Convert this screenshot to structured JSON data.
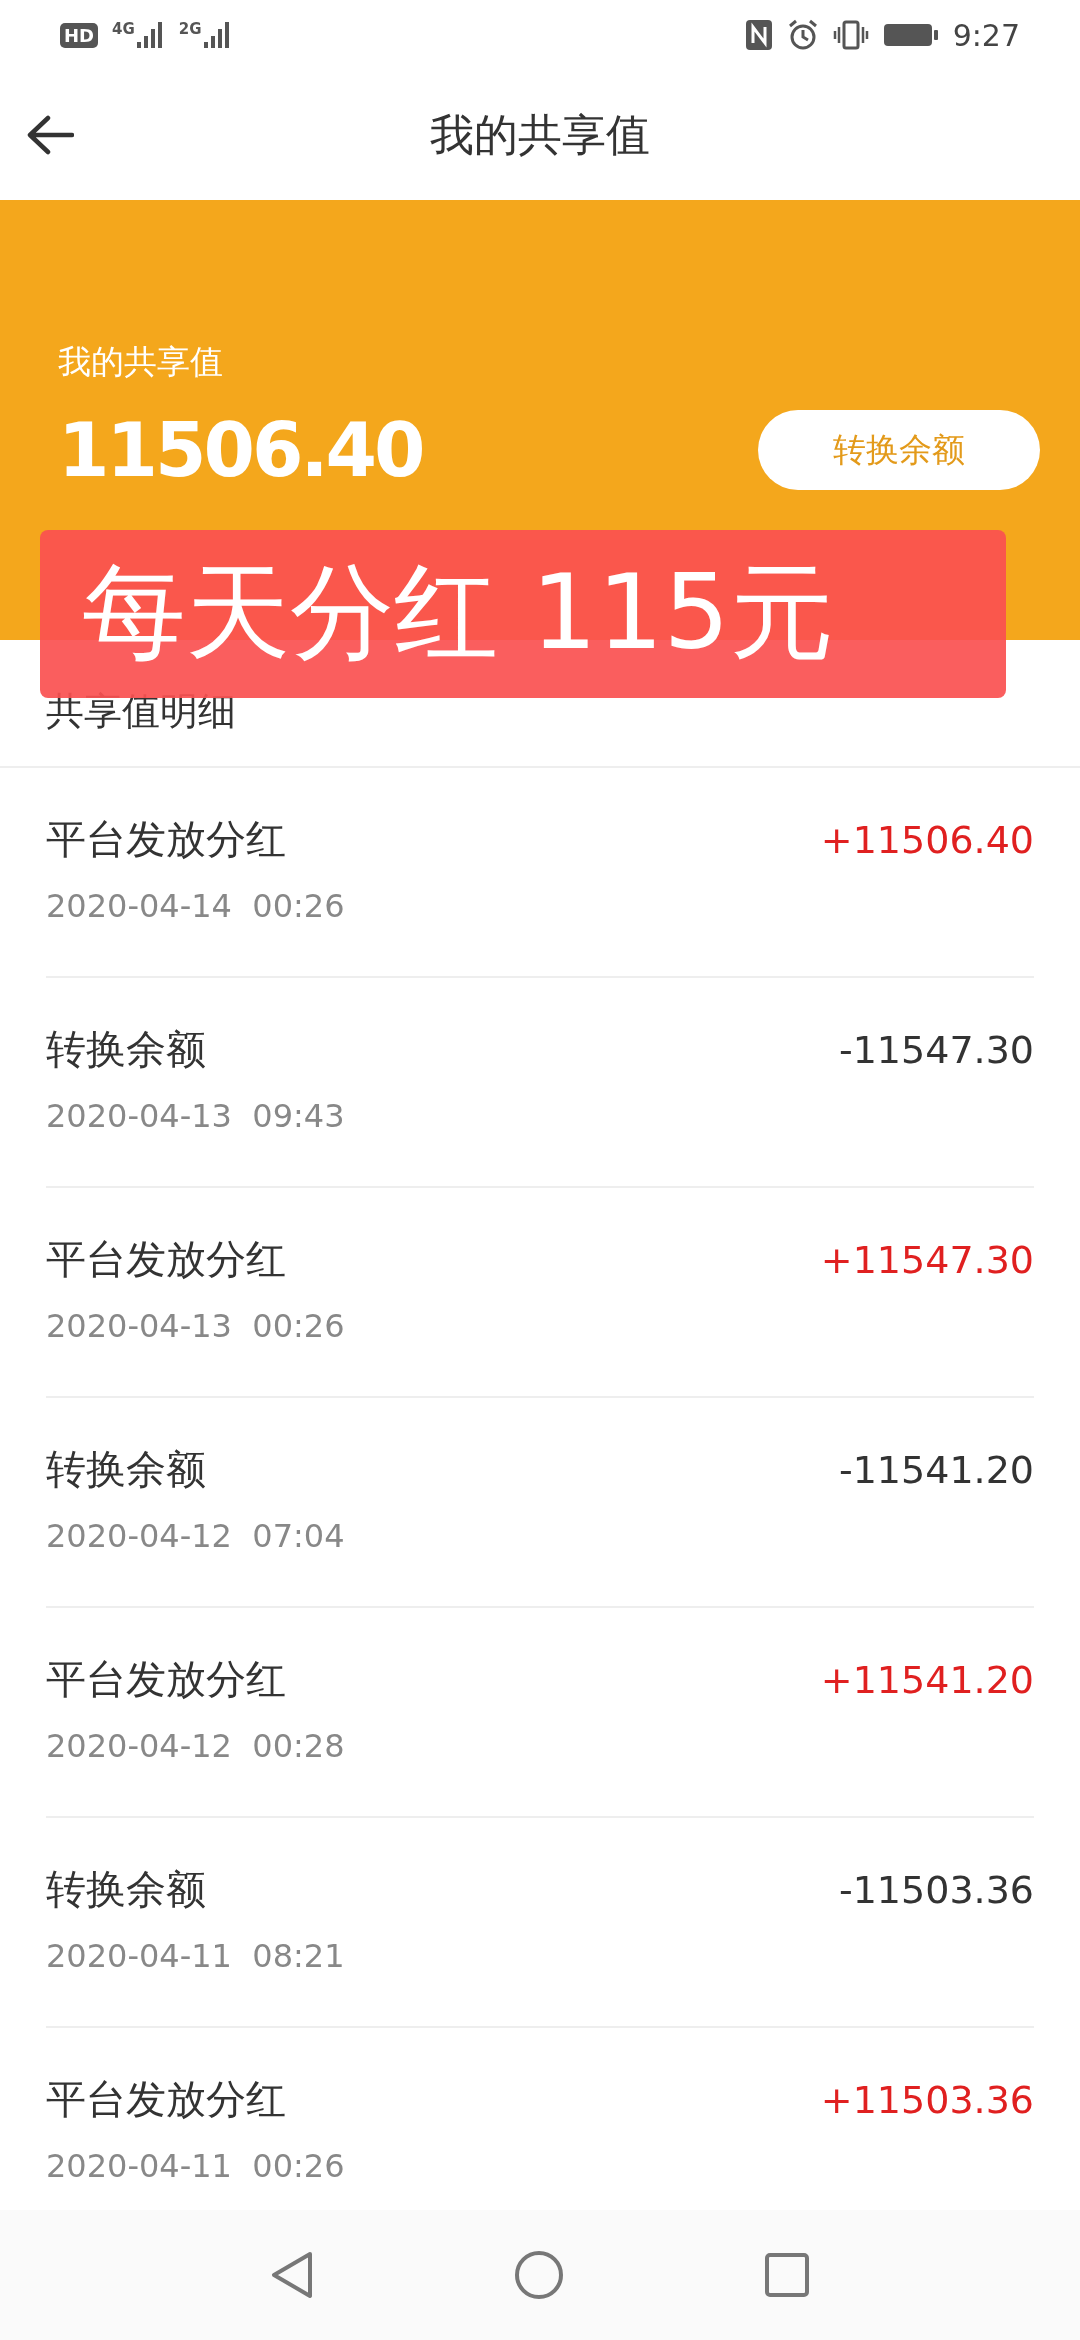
{
  "status_bar": {
    "indicators": [
      "HD",
      "4G",
      "2G"
    ],
    "time": "9:27"
  },
  "header": {
    "title": "我的共享值"
  },
  "summary": {
    "label": "我的共享值",
    "value": "11506.40",
    "button": "转换余额"
  },
  "overlay_banner": {
    "text": "每天分红 115元"
  },
  "section_title": "共享值明细",
  "records": [
    {
      "title": "平台发放分红",
      "time": "2020-04-14  00:26",
      "amount": "+11506.40",
      "kind": "income"
    },
    {
      "title": "转换余额",
      "time": "2020-04-13  09:43",
      "amount": "-11547.30",
      "kind": "expense"
    },
    {
      "title": "平台发放分红",
      "time": "2020-04-13  00:26",
      "amount": "+11547.30",
      "kind": "income"
    },
    {
      "title": "转换余额",
      "time": "2020-04-12  07:04",
      "amount": "-11541.20",
      "kind": "expense"
    },
    {
      "title": "平台发放分红",
      "time": "2020-04-12  00:28",
      "amount": "+11541.20",
      "kind": "income"
    },
    {
      "title": "转换余额",
      "time": "2020-04-11  08:21",
      "amount": "-11503.36",
      "kind": "expense"
    },
    {
      "title": "平台发放分红",
      "time": "2020-04-11  00:26",
      "amount": "+11503.36",
      "kind": "income"
    }
  ]
}
